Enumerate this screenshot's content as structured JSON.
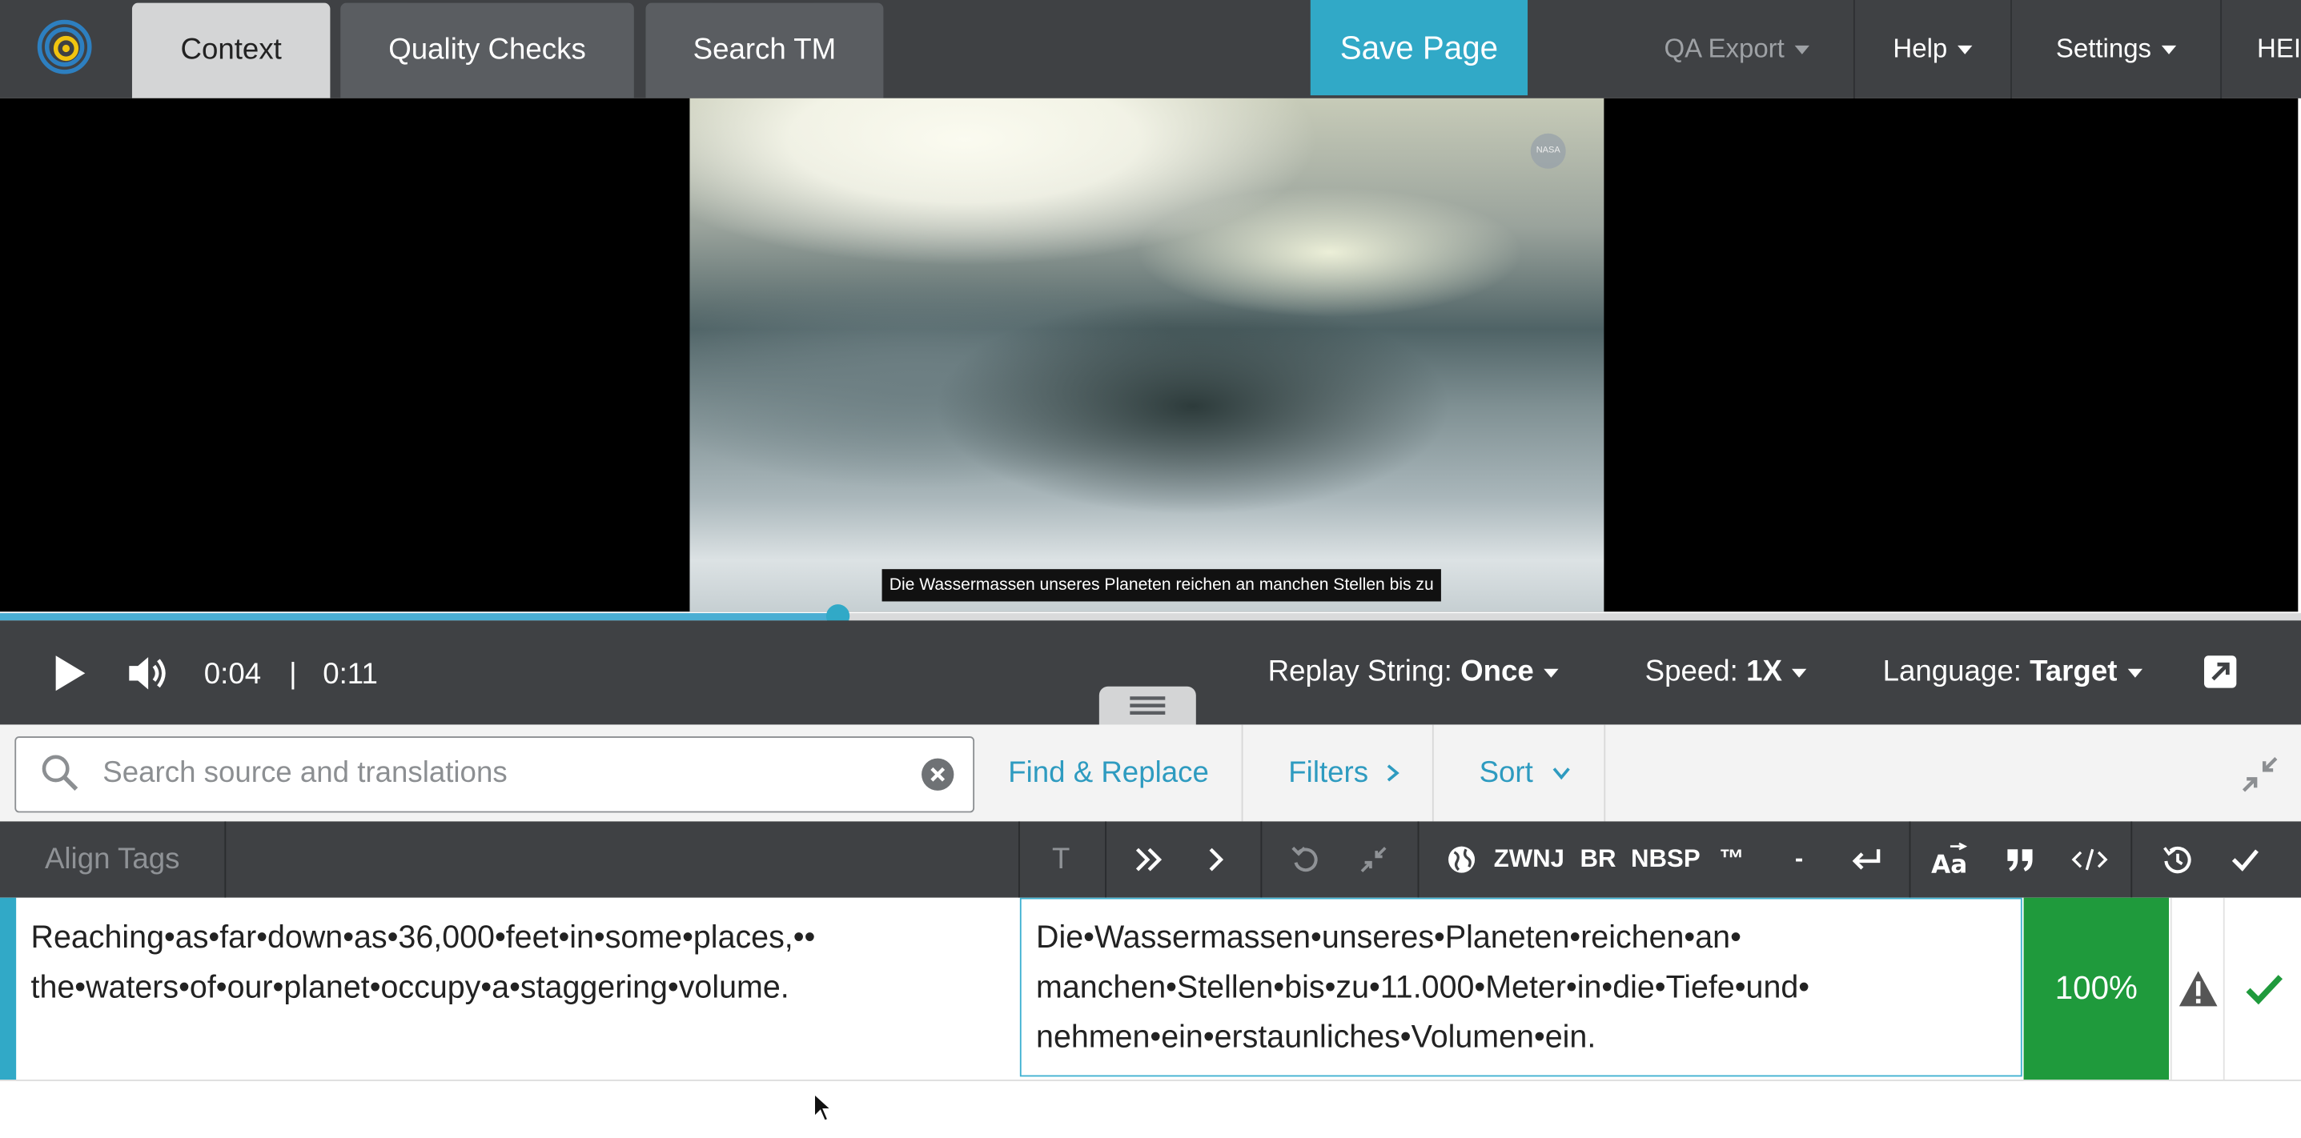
{
  "tabs": [
    {
      "label": "Context",
      "active": true
    },
    {
      "label": "Quality Checks",
      "active": false
    },
    {
      "label": "Search TM",
      "active": false
    }
  ],
  "header": {
    "save_label": "Save Page",
    "qa_export": "QA Export",
    "help": "Help",
    "settings": "Settings",
    "extra": "HEI"
  },
  "video": {
    "subtitle": "Die Wassermassen unseres Planeten reichen an manchen Stellen bis zu",
    "watermark": "NASA",
    "progress": 0.364
  },
  "player": {
    "current_time": "0:04",
    "separator": "|",
    "duration": "0:11",
    "replay_label": "Replay String:",
    "replay_value": "Once",
    "speed_label": "Speed:",
    "speed_value": "1X",
    "language_label": "Language:",
    "language_value": "Target"
  },
  "search": {
    "placeholder": "Search source and translations",
    "find_replace": "Find & Replace",
    "filters": "Filters",
    "sort": "Sort"
  },
  "toolbar": {
    "align_tags": "Align Tags",
    "t": "T",
    "zwnj": "ZWNJ",
    "br": "BR",
    "nbsp": "NBSP",
    "tm": "™",
    "dash": "-"
  },
  "segment": {
    "source_lines": [
      "Reaching•as•far•down•as•36,000•feet•in•some•places,••",
      "the•waters•of•our•planet•occupy•a•staggering•volume."
    ],
    "target_lines": [
      "Die•Wassermassen•unseres•Planeten•reichen•an•",
      "manchen•Stellen•bis•zu•11.000•Meter•in•die•Tiefe•und•",
      "nehmen•ein•erstaunliches•Volumen•ein."
    ],
    "match_score": "100%"
  },
  "colors": {
    "accent": "#31a9c7",
    "topbar": "#3f4144",
    "match_green": "#1f9a3c"
  }
}
